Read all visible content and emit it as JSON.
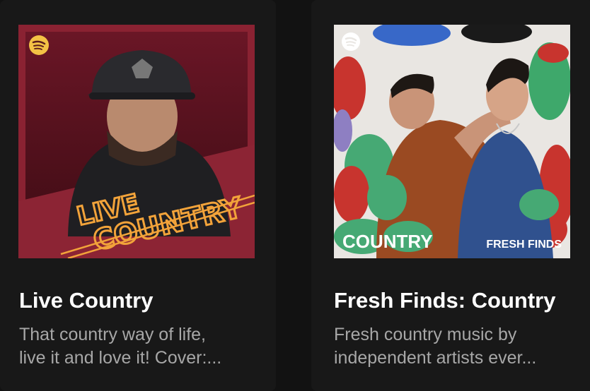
{
  "playlists": [
    {
      "title": "Live Country",
      "description_line1": "That country way of life,",
      "description_line2": "live it and love it! Cover:...",
      "cover_text_line1": "LIVE",
      "cover_text_line2": "COUNTRY",
      "colors": {
        "background": "#7a1e2b",
        "neon": "#f2a33a"
      }
    },
    {
      "title": "Fresh Finds: Country",
      "description_line1": "Fresh country music by",
      "description_line2": "independent artists ever...",
      "cover_text_left": "COUNTRY",
      "cover_text_right": "FRESH FINDS",
      "colors": {
        "background": "#e9e6e2"
      }
    }
  ],
  "icons": {
    "brand": "spotify-logo-icon"
  }
}
